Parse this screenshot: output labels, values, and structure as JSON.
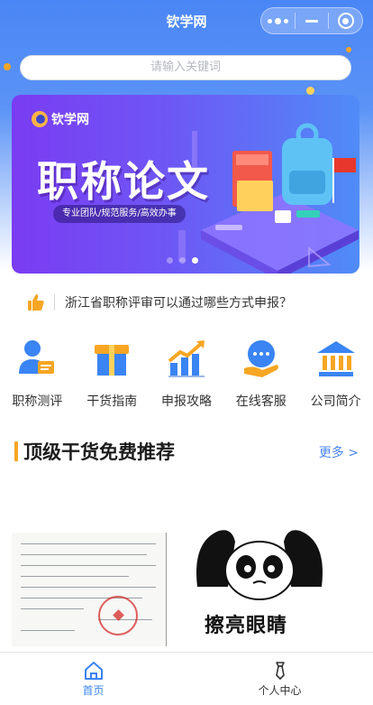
{
  "navbar": {
    "title": "钦学网",
    "capsule": {
      "more_icon": "more-dots-icon",
      "minimize_icon": "minimize-icon",
      "close_icon": "target-icon"
    }
  },
  "search": {
    "placeholder": "请输入关键词"
  },
  "banner": {
    "logo_text": "钦学网",
    "title": "职称论文",
    "subtitle": "专业团队/规范服务/高效办事",
    "slide_count": 3,
    "active_slide": 3,
    "colors": {
      "start": "#7a3cf2",
      "end": "#4f8cf7"
    }
  },
  "notice": {
    "icon": "thumbs-up-icon",
    "text": "浙江省职称评审可以通过哪些方式申报？"
  },
  "grid": [
    {
      "label": "职称测评",
      "icon": "person-card-icon"
    },
    {
      "label": "干货指南",
      "icon": "gift-box-icon"
    },
    {
      "label": "申报攻略",
      "icon": "trend-chart-icon"
    },
    {
      "label": "在线客服",
      "icon": "chat-hand-icon"
    },
    {
      "label": "公司简介",
      "icon": "building-icon"
    }
  ],
  "section": {
    "title": "顶级干货免费推荐",
    "more": "更多 >",
    "accent_color": "#f6a623"
  },
  "preview": {
    "meme_caption": "擦亮眼睛"
  },
  "tabbar": [
    {
      "label": "首页",
      "icon": "home-icon",
      "active": true
    },
    {
      "label": "个人中心",
      "icon": "tie-icon",
      "active": false
    }
  ],
  "colors": {
    "primary": "#4a86f5",
    "tab_active": "#3a84f3"
  }
}
